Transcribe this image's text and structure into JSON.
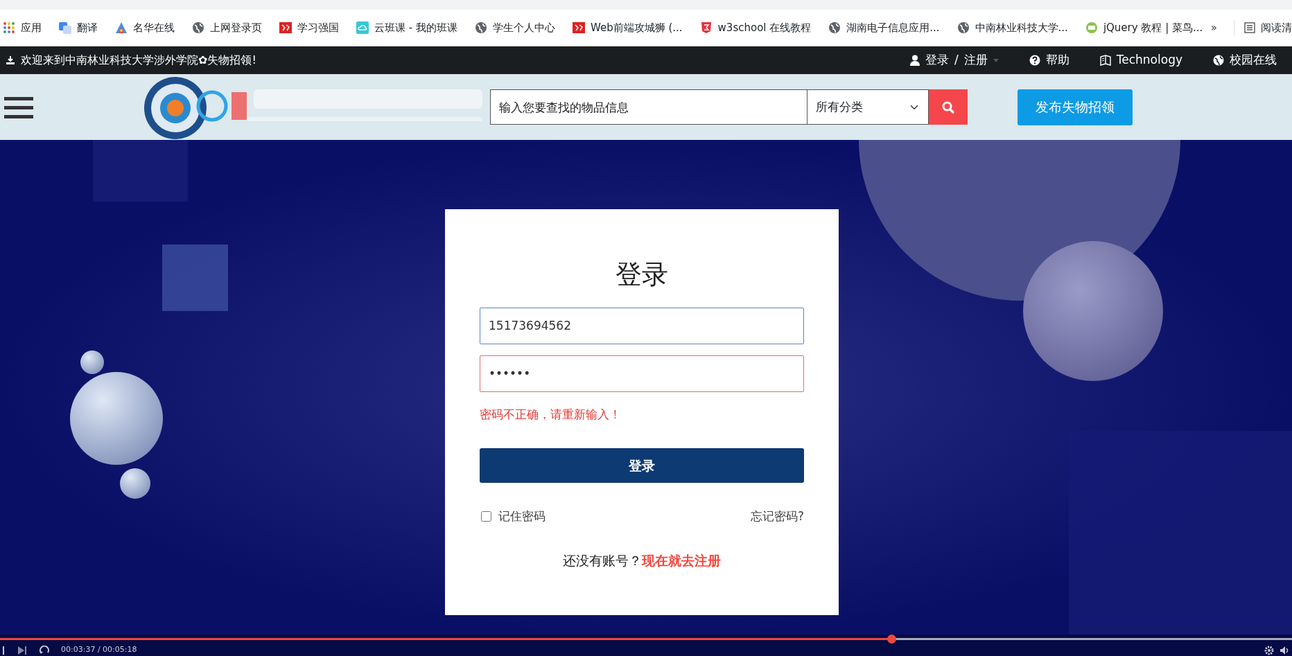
{
  "bookmarks_bar": {
    "items": [
      {
        "label": "应用",
        "kind": "apps"
      },
      {
        "label": "翻译",
        "kind": "translate"
      },
      {
        "label": "名华在线",
        "kind": "triangle"
      },
      {
        "label": "上网登录页",
        "kind": "globe"
      },
      {
        "label": "学习强国",
        "kind": "seal"
      },
      {
        "label": "云班课 - 我的班课",
        "kind": "cloud"
      },
      {
        "label": "学生个人中心",
        "kind": "globe"
      },
      {
        "label": "Web前端攻城狮 (...",
        "kind": "seal"
      },
      {
        "label": "w3school 在线教程",
        "kind": "shield"
      },
      {
        "label": "湖南电子信息应用...",
        "kind": "globe"
      },
      {
        "label": "中南林业科技大学...",
        "kind": "globe"
      },
      {
        "label": "jQuery 教程 | 菜鸟...",
        "kind": "ring"
      }
    ],
    "overflow": "»",
    "reading_list": "阅读清"
  },
  "top_bar": {
    "welcome": "欢迎来到中南林业科技大学涉外学院✿失物招领!",
    "account": {
      "login": "登录",
      "separator": "/",
      "register": "注册"
    },
    "links": [
      {
        "label": "帮助",
        "kind": "help"
      },
      {
        "label": "Technology",
        "kind": "book"
      },
      {
        "label": "校园在线",
        "kind": "globe"
      }
    ]
  },
  "header": {
    "search": {
      "placeholder": "输入您要查找的物品信息"
    },
    "category": "所有分类",
    "publish_button": "发布失物招领"
  },
  "login_card": {
    "title": "登录",
    "username": {
      "value": "15173694562",
      "invalid": false
    },
    "password": {
      "value": "••••••",
      "invalid": true
    },
    "error": "密码不正确，请重新输入！",
    "submit": "登录",
    "remember": {
      "label": "记住密码",
      "checked": false
    },
    "forgot": "忘记密码?",
    "register_prompt": "还没有账号？",
    "register_link": "现在就去注册"
  },
  "video_player": {
    "progress": {
      "level": 0.69
    },
    "time": "00:03:37 / 00:05:18"
  }
}
